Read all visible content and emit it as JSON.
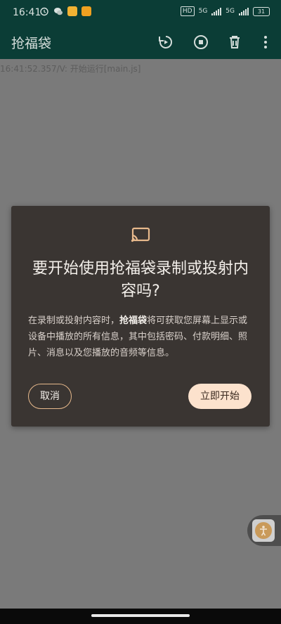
{
  "status_bar": {
    "time": "16:41",
    "hd_label": "HD",
    "network_1": "5G",
    "network_2": "5G",
    "battery": "31"
  },
  "toolbar": {
    "title": "抢福袋",
    "icons": [
      "replay-icon",
      "stop-icon",
      "delete-icon",
      "more-vert-icon"
    ]
  },
  "log": {
    "line": "16:41:52.357/V: 开始运行[main.js]"
  },
  "dialog": {
    "title": "要开始使用抢福袋录制或投射内容吗?",
    "body_prefix": "在录制或投射内容时，",
    "body_app": "抢福袋",
    "body_suffix": "将可获取您屏幕上显示或设备中播放的所有信息，其中包括密码、付款明细、照片、消息以及您播放的音频等信息。",
    "cancel_label": "取消",
    "start_label": "立即开始",
    "accent_color": "#e7b98c"
  },
  "colors": {
    "toolbar": "#0b3d36",
    "dialog_bg": "#3a3532",
    "start_button": "#fce2cd"
  }
}
